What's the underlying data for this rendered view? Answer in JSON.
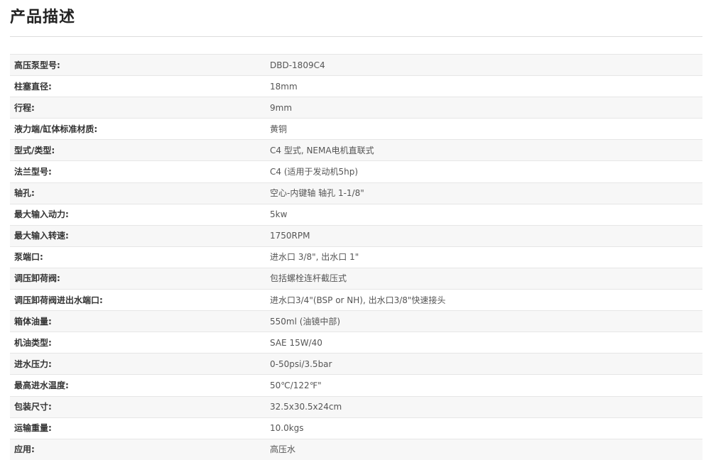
{
  "section": {
    "title": "产品描述"
  },
  "specs": [
    {
      "label": "高压泵型号:",
      "value": "DBD-1809C4"
    },
    {
      "label": "柱塞直径:",
      "value": "18mm"
    },
    {
      "label": "行程:",
      "value": "9mm"
    },
    {
      "label": "液力端/缸体标准材质:",
      "value": "黄铜"
    },
    {
      "label": "型式/类型:",
      "value": "C4 型式, NEMA电机直联式"
    },
    {
      "label": "法兰型号:",
      "value": "C4 (适用于发动机5hp)"
    },
    {
      "label": "轴孔:",
      "value": "空心-内键轴  轴孔 1-1/8\""
    },
    {
      "label": "最大输入动力:",
      "value": "5kw"
    },
    {
      "label": "最大输入转速:",
      "value": "1750RPM"
    },
    {
      "label": "泵端口:",
      "value": "进水口 3/8\", 出水口 1\""
    },
    {
      "label": "调压卸荷阀:",
      "value": "包括螺栓连杆截压式"
    },
    {
      "label": "调压卸荷阀进出水端口:",
      "value": "进水口3/4\"(BSP or NH), 出水口3/8\"快速接头"
    },
    {
      "label": "箱体油量:",
      "value": "550ml (油镜中部)"
    },
    {
      "label": "机油类型:",
      "value": "SAE 15W/40"
    },
    {
      "label": "进水压力:",
      "value": "0-50psi/3.5bar"
    },
    {
      "label": "最高进水温度:",
      "value": "50℃/122℉\""
    },
    {
      "label": "包装尺寸:",
      "value": "32.5x30.5x24cm"
    },
    {
      "label": "运输重量:",
      "value": "10.0kgs"
    },
    {
      "label": "应用:",
      "value": "高压水"
    }
  ]
}
